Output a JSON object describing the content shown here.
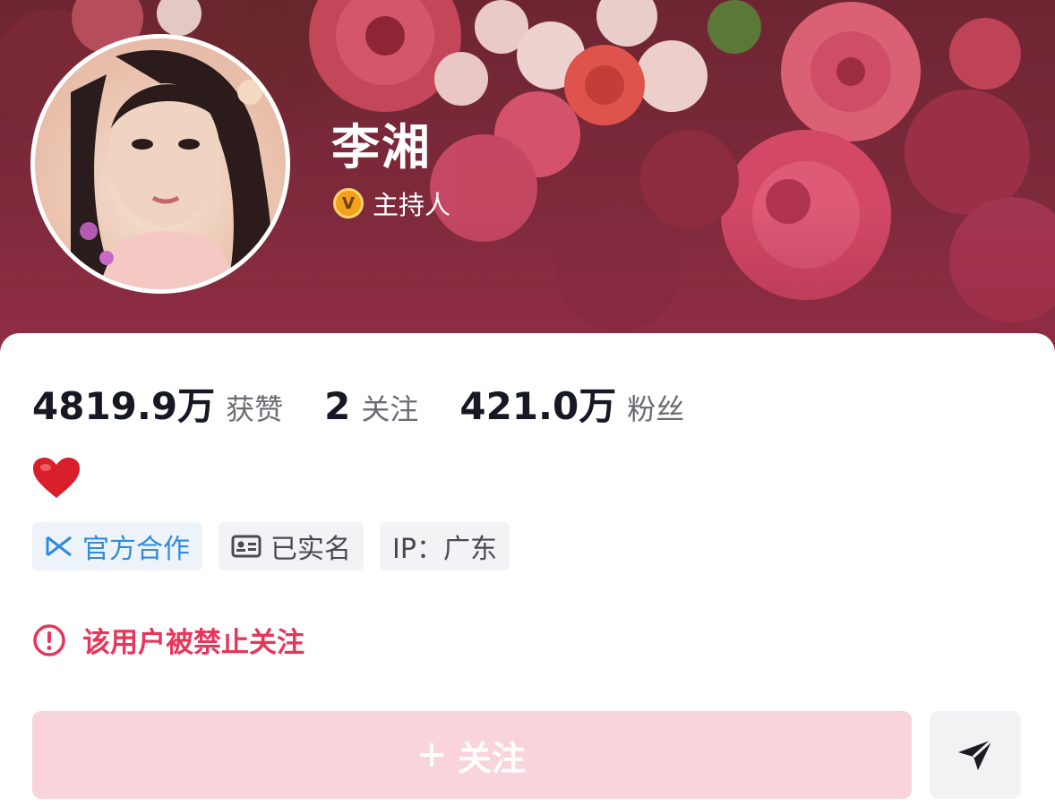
{
  "profile": {
    "name": "李湘",
    "verified_badge": "V",
    "role": "主持人"
  },
  "stats": [
    {
      "value": "4819.9万",
      "label": "获赞"
    },
    {
      "value": "2",
      "label": "关注"
    },
    {
      "value": "421.0万",
      "label": "粉丝"
    }
  ],
  "bio": {
    "icon": "red-heart-emoji"
  },
  "tags": [
    {
      "icon": "official-cooperation-icon",
      "label": "官方合作"
    },
    {
      "icon": "id-card-icon",
      "label": "已实名"
    },
    {
      "label": "IP：广东"
    }
  ],
  "notice": {
    "icon": "warning-circle-icon",
    "text": "该用户被禁止关注"
  },
  "actions": {
    "follow_label": "关注",
    "follow_icon": "plus-icon",
    "share_icon": "send-icon"
  },
  "colors": {
    "accent_red": "#e8355a",
    "follow_disabled_bg": "#f9d4da",
    "official_blue": "#2f8be0",
    "badge_gold": "#f1a21a"
  }
}
